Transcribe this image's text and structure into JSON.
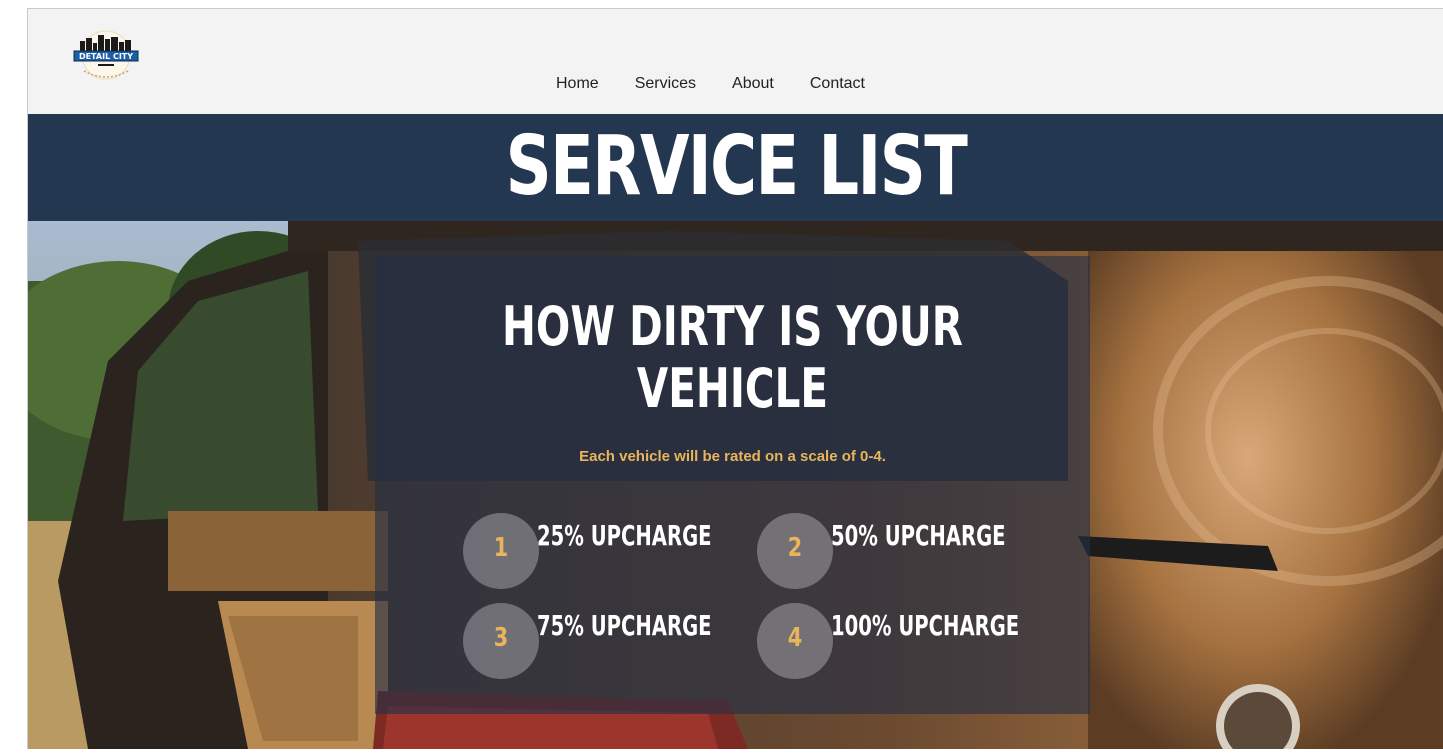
{
  "header": {
    "logo_text": "DETAIL CITY",
    "nav": [
      "Home",
      "Services",
      "About",
      "Contact"
    ]
  },
  "banner": {
    "title": "SERVICE LIST"
  },
  "panel": {
    "heading": "HOW DIRTY IS YOUR VEHICLE",
    "subtitle": "Each vehicle will be rated on a scale of 0-4.",
    "ratings": [
      {
        "number": "1",
        "label": "25% UPCHARGE"
      },
      {
        "number": "2",
        "label": "50% UPCHARGE"
      },
      {
        "number": "3",
        "label": "75% UPCHARGE"
      },
      {
        "number": "4",
        "label": "100% UPCHARGE"
      }
    ]
  },
  "colors": {
    "navy": "#243750",
    "accent": "#e9b45c",
    "header_bg": "#f3f3f3"
  }
}
